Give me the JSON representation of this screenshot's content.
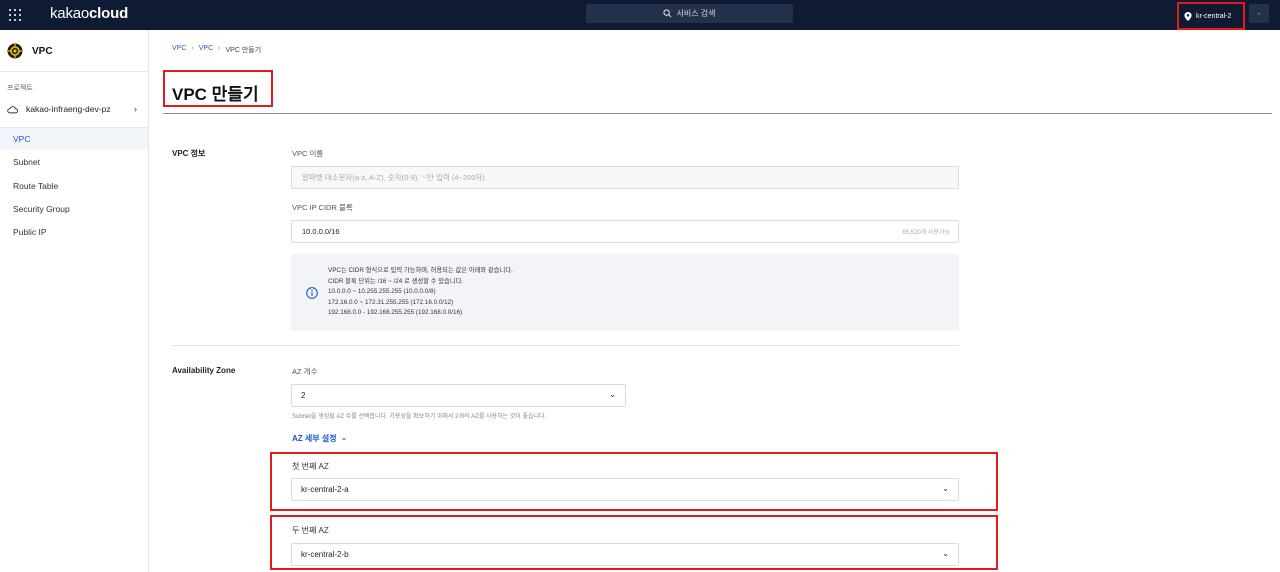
{
  "topbar": {
    "logo_light": "kakao",
    "logo_bold": "cloud",
    "search_label": "서비스 검색",
    "region": "kr-central-2",
    "user_menu": "-"
  },
  "sidebar": {
    "service_name": "VPC",
    "project_label": "프로젝트",
    "project_name": "kakao-infraeng-dev-pz",
    "items": [
      {
        "label": "VPC"
      },
      {
        "label": "Subnet"
      },
      {
        "label": "Route Table"
      },
      {
        "label": "Security Group"
      },
      {
        "label": "Public IP"
      }
    ]
  },
  "breadcrumb": [
    "VPC",
    "VPC",
    "VPC 만들기"
  ],
  "page_title": "VPC 만들기",
  "vpc_info": {
    "section_label": "VPC 정보",
    "name_label": "VPC 이름",
    "name_placeholder": "알파벳 대소문자(a-z, A-Z), 숫자(0-9), '-'만 입력 (4~200자)",
    "cidr_label": "VPC IP CIDR 블록",
    "cidr_value": "10.0.0.0/16",
    "cidr_suffix": "65,520개 사용가능",
    "info_lines": [
      "VPC는 CIDR 형식으로 입력 가능하며, 허용되는 값은 아래와 같습니다.",
      "CIDR 블록 단위는 /16 ~ /24 로 생성할 수 있습니다.",
      "10.0.0.0 ~ 10.255.255.255 (10.0.0.0/8)",
      "172.16.0.0 ~ 172.31.255.255 (172.16.0.0/12)",
      "192.168.0.0 - 192.168.255.255 (192.168.0.0/16)"
    ]
  },
  "az": {
    "section_label": "Availability Zone",
    "count_label": "AZ 개수",
    "count_value": "2",
    "hint": "Subnet을 생성할 AZ 수를 선택합니다. 가용성을 확보하기 위해서 2개의 AZ를 사용하는 것이 좋습니다.",
    "detail_toggle": "AZ 세부 설정",
    "first_label": "첫 번째 AZ",
    "first_value": "kr-central-2-a",
    "second_label": "두 번째 AZ",
    "second_value": "kr-central-2-b"
  }
}
